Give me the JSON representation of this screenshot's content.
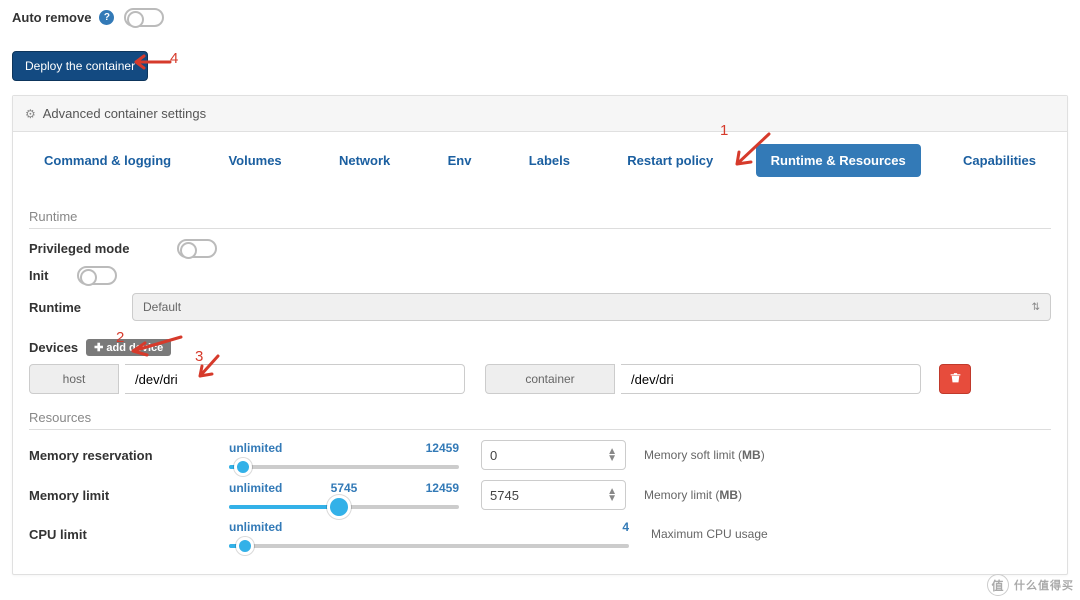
{
  "top": {
    "auto_remove_label": "Auto remove",
    "deploy_label": "Deploy the container"
  },
  "settings_header": "Advanced container settings",
  "tabs": [
    {
      "key": "cmd",
      "label": "Command & logging"
    },
    {
      "key": "vol",
      "label": "Volumes"
    },
    {
      "key": "net",
      "label": "Network"
    },
    {
      "key": "env",
      "label": "Env"
    },
    {
      "key": "lab",
      "label": "Labels"
    },
    {
      "key": "rst",
      "label": "Restart policy"
    },
    {
      "key": "run",
      "label": "Runtime & Resources"
    },
    {
      "key": "cap",
      "label": "Capabilities"
    }
  ],
  "sections": {
    "runtime_title": "Runtime",
    "privileged_label": "Privileged mode",
    "init_label": "Init",
    "runtime_label": "Runtime",
    "runtime_selected": "Default",
    "devices_label": "Devices",
    "add_device_label": "add device",
    "device_row": {
      "host_addon": "host",
      "host_value": "/dev/dri",
      "container_addon": "container",
      "container_value": "/dev/dri"
    },
    "resources_title": "Resources"
  },
  "resources": {
    "mem_res": {
      "label": "Memory reservation",
      "left": "unlimited",
      "right": "12459",
      "numeric": "0",
      "hint_prefix": "Memory soft limit (",
      "hint_unit": "MB",
      "hint_suffix": ")",
      "fill_pct": 6,
      "thumb_pct": 6
    },
    "mem_lim": {
      "label": "Memory limit",
      "left": "unlimited",
      "mid": "5745",
      "right": "12459",
      "numeric": "5745",
      "hint_prefix": "Memory limit (",
      "hint_unit": "MB",
      "hint_suffix": ")",
      "fill_pct": 48,
      "thumb_pct": 48
    },
    "cpu_lim": {
      "label": "CPU limit",
      "left": "unlimited",
      "right": "4",
      "hint": "Maximum CPU usage",
      "fill_pct": 6,
      "thumb_pct": 6,
      "wide": true
    }
  },
  "annotations": {
    "1": "1",
    "2": "2",
    "3": "3",
    "4": "4"
  },
  "watermark": {
    "a": "值",
    "b": "什么值得买"
  }
}
